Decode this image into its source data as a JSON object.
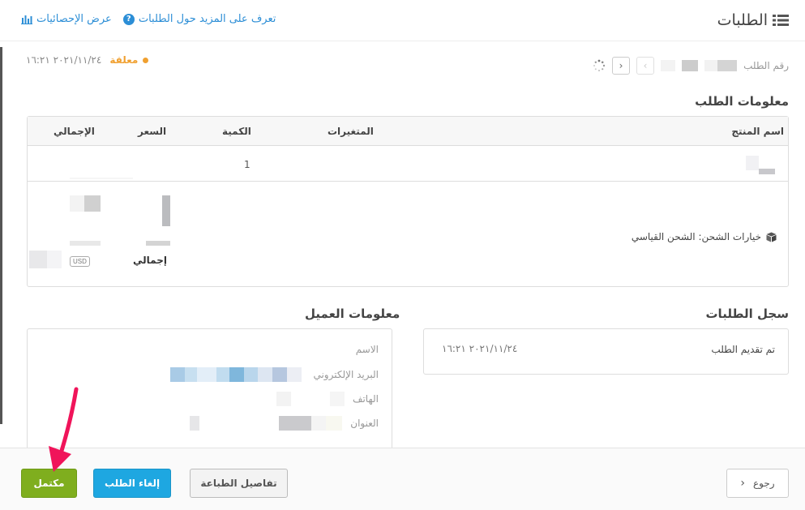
{
  "header": {
    "title": "الطلبات",
    "stats_link": "عرض الإحصائيات",
    "learn_more_link": "تعرف على المزيد حول الطلبات"
  },
  "order": {
    "number_label": "رقم الطلب",
    "status": "معلقة",
    "date": "٢٠٢١/١١/٢٤ ١٦:٢١",
    "status_color": "#f0a030"
  },
  "order_info": {
    "title": "معلومات الطلب",
    "columns": {
      "product": "اسم المنتج",
      "variants": "المتغيرات",
      "quantity": "الكمية",
      "price": "السعر",
      "total": "الإجمالي"
    },
    "items": [
      {
        "quantity": "1"
      }
    ],
    "shipping_label": "خيارات الشحن: الشحن القياسي",
    "total_label": "إجمالي",
    "currency": "USD"
  },
  "history": {
    "title": "سجل الطلبات",
    "entries": [
      {
        "label": "تم تقديم الطلب",
        "date": "٢٠٢١/١١/٢٤ ١٦:٢١"
      }
    ]
  },
  "customer": {
    "title": "معلومات العميل",
    "name_label": "الاسم",
    "email_label": "البريد الإلكتروني",
    "phone_label": "الهاتف",
    "address_label": "العنوان"
  },
  "footer": {
    "back": "رجوع",
    "print": "تفاصيل الطباعة",
    "cancel": "إلغاء الطلب",
    "complete": "مكتمل"
  },
  "colors": {
    "link": "#2c8ed6",
    "cancel_button": "#1ea7e1",
    "complete_button": "#7fae1e",
    "annotation_arrow": "#f0145a"
  }
}
